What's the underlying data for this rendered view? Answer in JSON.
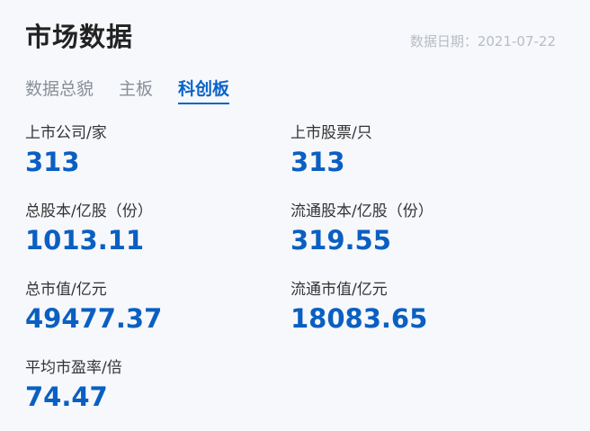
{
  "header": {
    "title": "市场数据",
    "date_text": "数据日期：2021-07-22"
  },
  "tabs": [
    {
      "label": "数据总貌",
      "active": false
    },
    {
      "label": "主板",
      "active": false
    },
    {
      "label": "科创板",
      "active": true
    }
  ],
  "stats": [
    {
      "label": "上市公司/家",
      "value": "313"
    },
    {
      "label": "上市股票/只",
      "value": "313"
    },
    {
      "label": "总股本/亿股（份）",
      "value": "1013.11"
    },
    {
      "label": "流通股本/亿股（份）",
      "value": "319.55"
    },
    {
      "label": "总市值/亿元",
      "value": "49477.37"
    },
    {
      "label": "流通市值/亿元",
      "value": "18083.65"
    },
    {
      "label": "平均市盈率/倍",
      "value": "74.47"
    }
  ],
  "colors": {
    "accent": "#0a63c9",
    "value": "#0a5fc2",
    "title": "#222222",
    "muted": "#8a8f98",
    "background": "#f6f8fb"
  }
}
